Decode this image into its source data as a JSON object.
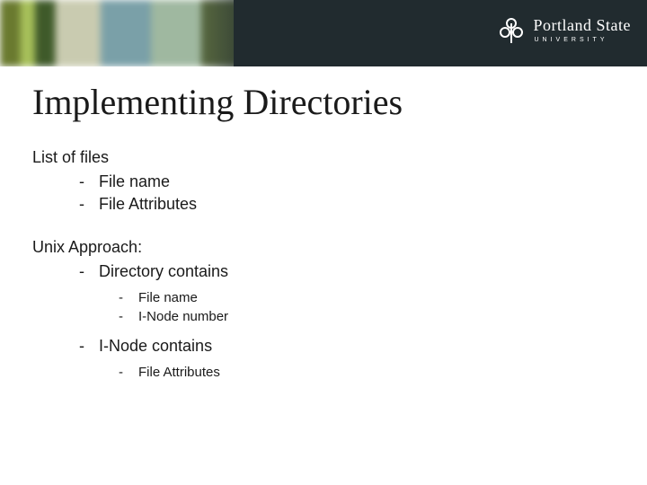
{
  "brand": {
    "name": "Portland State",
    "sub": "UNIVERSITY"
  },
  "slide": {
    "title": "Implementing Directories",
    "section1": {
      "heading": "List of files",
      "items": [
        "File name",
        "File Attributes"
      ]
    },
    "section2": {
      "heading": "Unix Approach:",
      "items": [
        {
          "label": "Directory contains",
          "sub": [
            "File name",
            "I-Node number"
          ]
        },
        {
          "label": "I-Node contains",
          "sub": [
            "File Attributes"
          ]
        }
      ]
    }
  }
}
